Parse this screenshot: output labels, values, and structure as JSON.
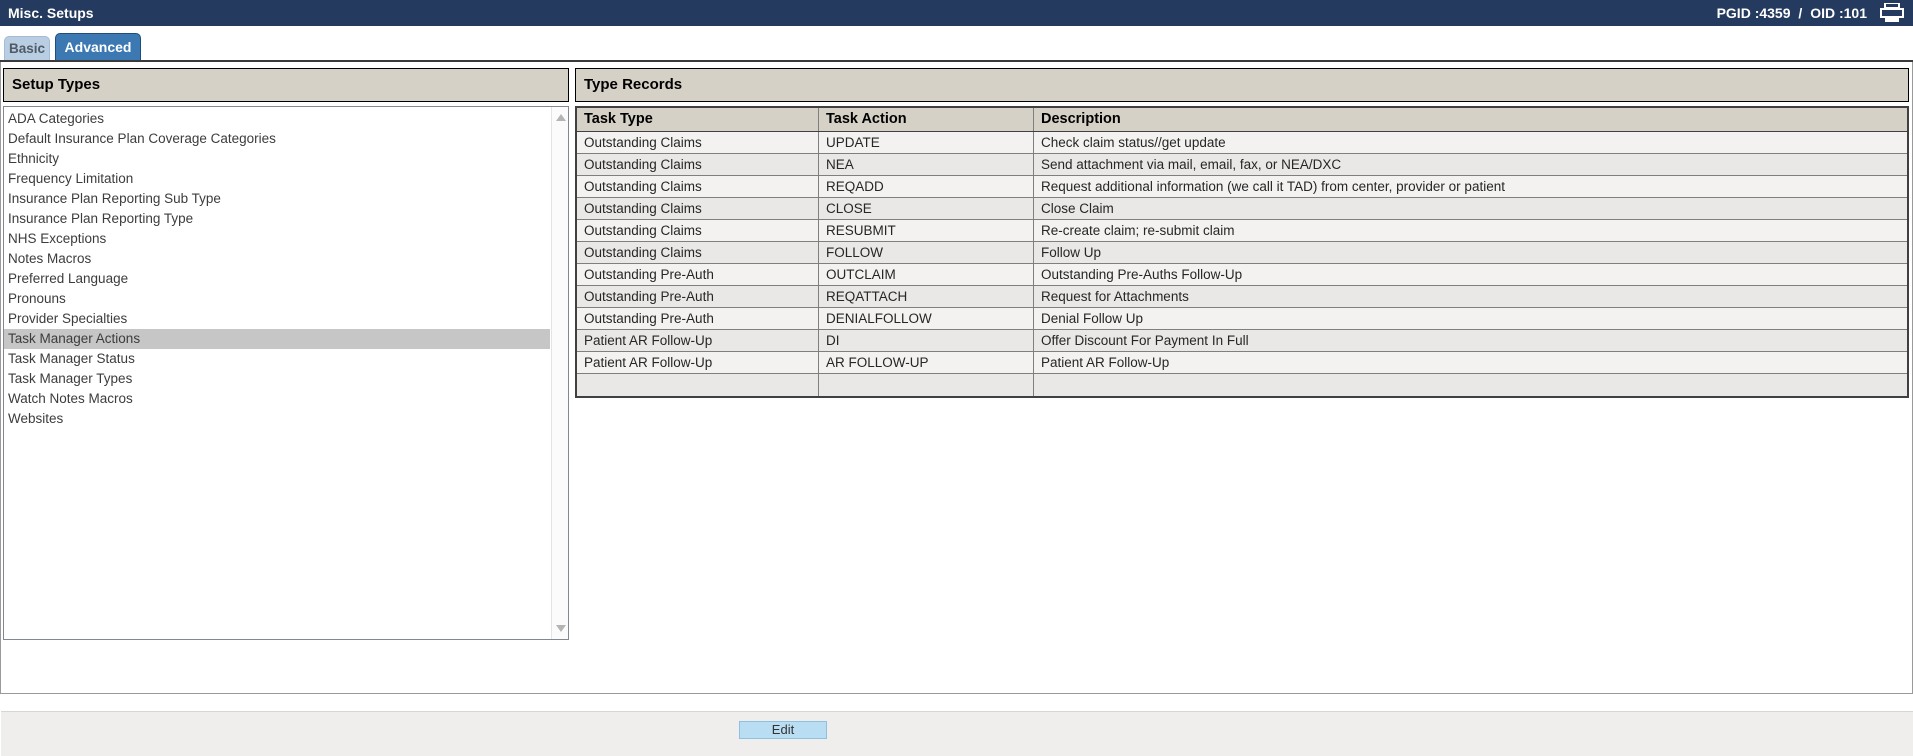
{
  "header": {
    "title": "Misc. Setups",
    "pgid": "PGID :4359",
    "separator": "/",
    "oid": "OID :101"
  },
  "tabs": [
    {
      "label": "Basic",
      "active": false
    },
    {
      "label": "Advanced",
      "active": true
    }
  ],
  "left_panel": {
    "title": "Setup Types",
    "items": [
      "ADA Categories",
      "Default Insurance Plan Coverage Categories",
      "Ethnicity",
      "Frequency Limitation",
      "Insurance Plan Reporting Sub Type",
      "Insurance Plan Reporting Type",
      "NHS Exceptions",
      "Notes Macros",
      "Preferred Language",
      "Pronouns",
      "Provider Specialties",
      "Task Manager Actions",
      "Task Manager Status",
      "Task Manager Types",
      "Watch Notes Macros",
      "Websites"
    ],
    "selected_index": 11,
    "selected_item": "Task Manager Actions"
  },
  "right_panel": {
    "title": "Type Records",
    "table": {
      "columns": [
        "Task Type",
        "Task Action",
        "Description"
      ],
      "rows": [
        [
          "Outstanding Claims",
          "UPDATE",
          "Check claim status//get update"
        ],
        [
          "Outstanding Claims",
          "NEA",
          "Send attachment via mail, email, fax, or NEA/DXC"
        ],
        [
          "Outstanding Claims",
          "REQADD",
          "Request additional information (we call it TAD) from center, provider or patient"
        ],
        [
          "Outstanding Claims",
          "CLOSE",
          "Close Claim"
        ],
        [
          "Outstanding Claims",
          "RESUBMIT",
          "Re-create claim; re-submit claim"
        ],
        [
          "Outstanding Claims",
          "FOLLOW",
          "Follow Up"
        ],
        [
          "Outstanding Pre-Auth",
          "OUTCLAIM",
          "Outstanding Pre-Auths Follow-Up"
        ],
        [
          "Outstanding Pre-Auth",
          "REQATTACH",
          "Request for Attachments"
        ],
        [
          "Outstanding Pre-Auth",
          "DENIALFOLLOW",
          "Denial Follow Up"
        ],
        [
          "Patient AR Follow-Up",
          "DI",
          "Offer Discount For Payment In Full"
        ],
        [
          "Patient AR Follow-Up",
          "AR FOLLOW-UP",
          "Patient AR Follow-Up"
        ],
        [
          "",
          "",
          ""
        ]
      ]
    }
  },
  "footer": {
    "edit_button": "Edit"
  },
  "colors": {
    "topbar": "#243a5e",
    "tab_active": "#3c78b1",
    "tab_inactive": "#b9cee3",
    "panel_header": "#d5d1c6",
    "selected_row": "#c6c6c6",
    "edit_button": "#b9ddf3"
  },
  "icons": {
    "printer": "printer-icon"
  }
}
